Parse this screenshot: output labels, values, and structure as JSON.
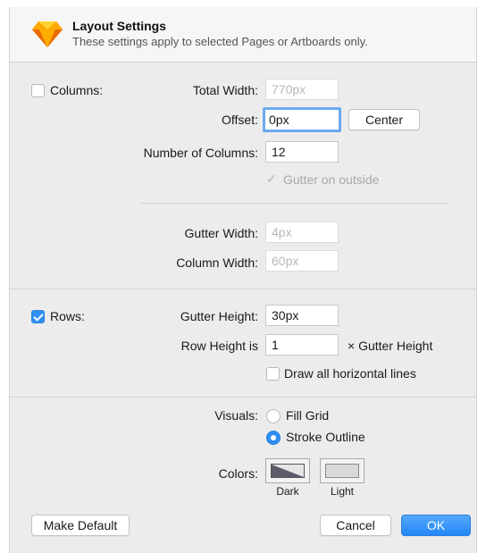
{
  "header": {
    "title": "Layout Settings",
    "subtitle": "These settings apply to selected Pages or Artboards only."
  },
  "columns": {
    "label": "Columns:",
    "checked": false,
    "total_width_label": "Total Width:",
    "total_width_value": "770px",
    "offset_label": "Offset:",
    "offset_value": "0px",
    "center_label": "Center",
    "num_columns_label": "Number of Columns:",
    "num_columns_value": "12",
    "gutter_outside_label": "Gutter on outside",
    "gutter_outside_checked": true,
    "gutter_width_label": "Gutter Width:",
    "gutter_width_value": "4px",
    "column_width_label": "Column Width:",
    "column_width_value": "60px"
  },
  "rows": {
    "label": "Rows:",
    "checked": true,
    "gutter_height_label": "Gutter Height:",
    "gutter_height_value": "30px",
    "row_height_label": "Row Height is",
    "row_height_value": "1",
    "row_height_suffix": "× Gutter Height",
    "draw_lines_label": "Draw all horizontal lines",
    "draw_lines_checked": false
  },
  "visuals": {
    "label": "Visuals:",
    "fill_grid_label": "Fill Grid",
    "stroke_outline_label": "Stroke Outline",
    "selected": "Stroke Outline"
  },
  "colors": {
    "label": "Colors:",
    "dark_label": "Dark",
    "light_label": "Light",
    "dark_color": "#333333",
    "light_color": "#d9d9d9"
  },
  "footer": {
    "make_default_label": "Make Default",
    "cancel_label": "Cancel",
    "ok_label": "OK"
  },
  "icons": {
    "logo": "sketch-diamond-icon"
  }
}
